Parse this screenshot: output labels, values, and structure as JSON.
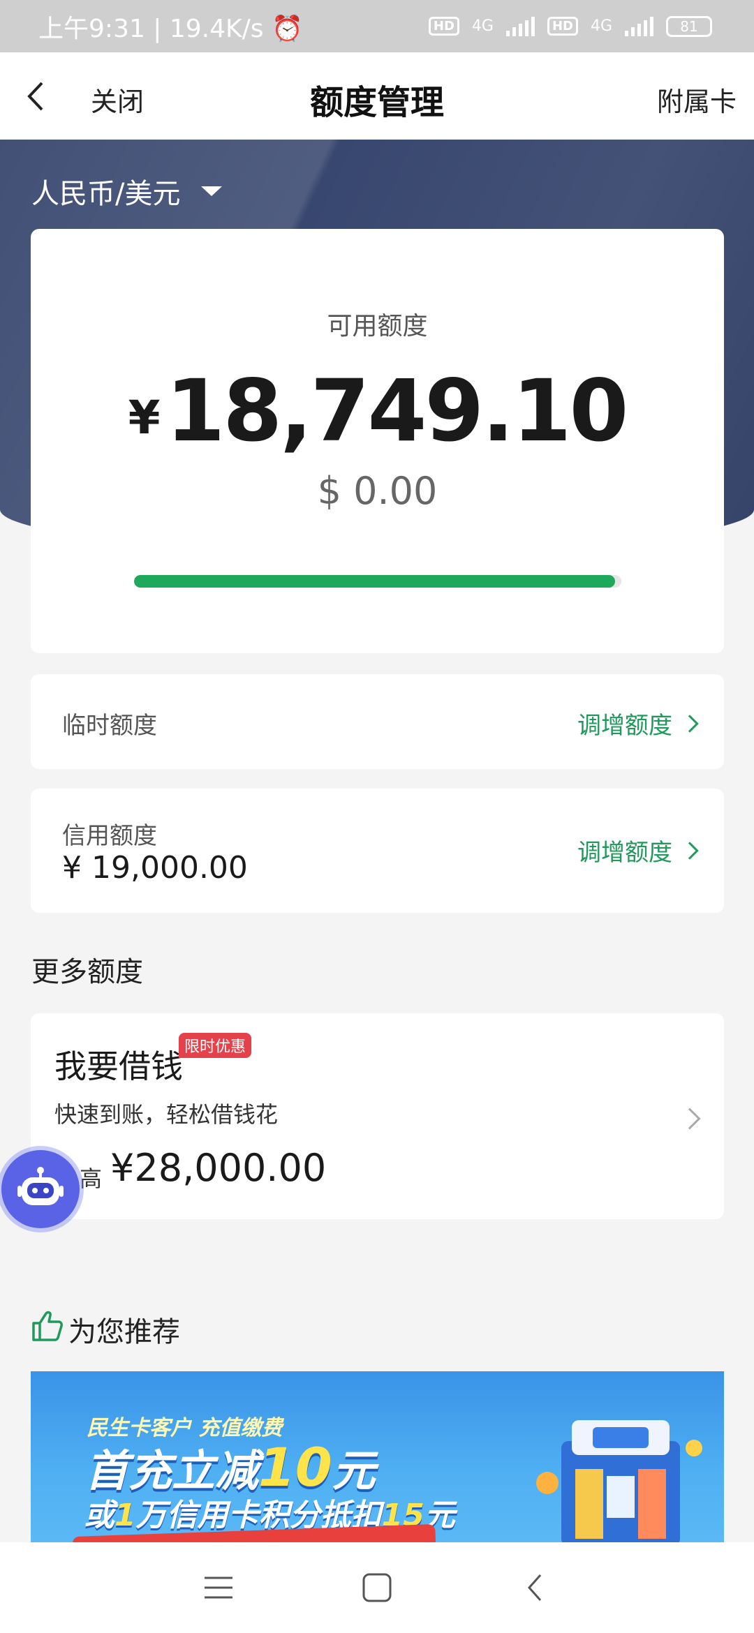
{
  "status_bar": {
    "time": "上午9:31",
    "net_speed": "19.4K/s",
    "hd1": "HD",
    "hd2": "HD",
    "net1": "4G",
    "net2": "4G",
    "battery": "81"
  },
  "nav": {
    "close_label": "关闭",
    "title": "额度管理",
    "right_label": "附属卡"
  },
  "currency_selector": {
    "label": "人民币/美元"
  },
  "available": {
    "label": "可用额度",
    "symbol": "¥",
    "amount": "18,749.10",
    "usd": "$ 0.00",
    "used_fraction": 0.987
  },
  "temporary": {
    "label": "临时额度",
    "action": "调增额度"
  },
  "credit": {
    "label": "信用额度",
    "value": "¥ 19,000.00",
    "action": "调增额度"
  },
  "more_section": {
    "title": "更多额度"
  },
  "loan": {
    "title": "我要借钱",
    "badge": "限时优惠",
    "subtitle": "快速到账，轻松借钱花",
    "prefix": "高",
    "amount": "¥28,000.00"
  },
  "recommend": {
    "title": "为您推荐"
  },
  "banner": {
    "line1": "民生卡客户  充值缴费",
    "line2a": "首充立减",
    "line2b": "10",
    "line2c": "元",
    "line3a": "或",
    "line3b": "1",
    "line3c": "万信用卡积分抵扣",
    "line3d": "15",
    "line3e": "元"
  },
  "colors": {
    "accent_green": "#1f9a5c",
    "hero_blue": "#38476f",
    "badge_red": "#e5414a",
    "robot": "#5a63e6"
  }
}
